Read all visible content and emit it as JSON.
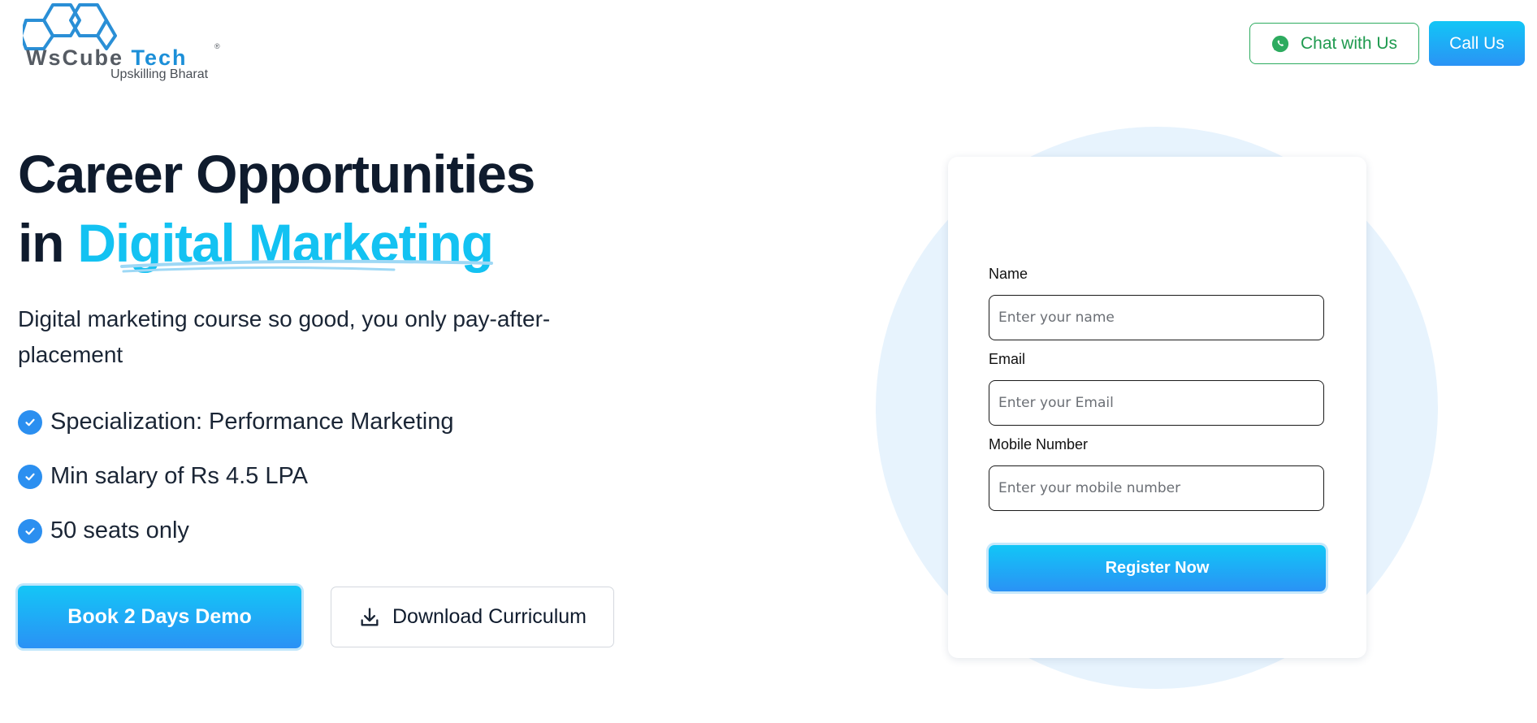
{
  "header": {
    "logo": {
      "brand_left": "WsCube",
      "brand_right": "Tech",
      "registered": "®",
      "tagline": "Upskilling Bharat"
    },
    "chat_button": {
      "label": "Chat with Us",
      "icon": "whatsapp-icon"
    },
    "call_button": {
      "label": "Call Us"
    }
  },
  "hero": {
    "title_line1": "Career Opportunities",
    "title_line2_prefix": "in ",
    "title_line2_accent": "Digital Marketing",
    "subtitle": "Digital marketing course so good, you only pay-after-placement",
    "features": [
      {
        "text": "Specialization: Performance Marketing",
        "icon": "check-circle-icon"
      },
      {
        "text": "Min salary of Rs 4.5 LPA",
        "icon": "check-circle-icon"
      },
      {
        "text": "50 seats only",
        "icon": "check-circle-icon"
      }
    ],
    "primary_button": {
      "label": "Book 2 Days Demo"
    },
    "secondary_button": {
      "label": "Download Curriculum",
      "icon": "download-icon"
    }
  },
  "form": {
    "name": {
      "label": "Name",
      "placeholder": "Enter your name",
      "value": ""
    },
    "email": {
      "label": "Email",
      "placeholder": "Enter your Email",
      "value": ""
    },
    "mobile": {
      "label": "Mobile Number",
      "placeholder": "Enter your mobile number",
      "value": ""
    },
    "submit_label": "Register Now"
  },
  "colors": {
    "accent": "#13c2f2",
    "button_gradient_top": "#12c6f6",
    "button_gradient_bottom": "#2a92f5",
    "whatsapp_green": "#2dab5f",
    "heading": "#0f1b2d",
    "form_backdrop": "#e7f3fd"
  }
}
